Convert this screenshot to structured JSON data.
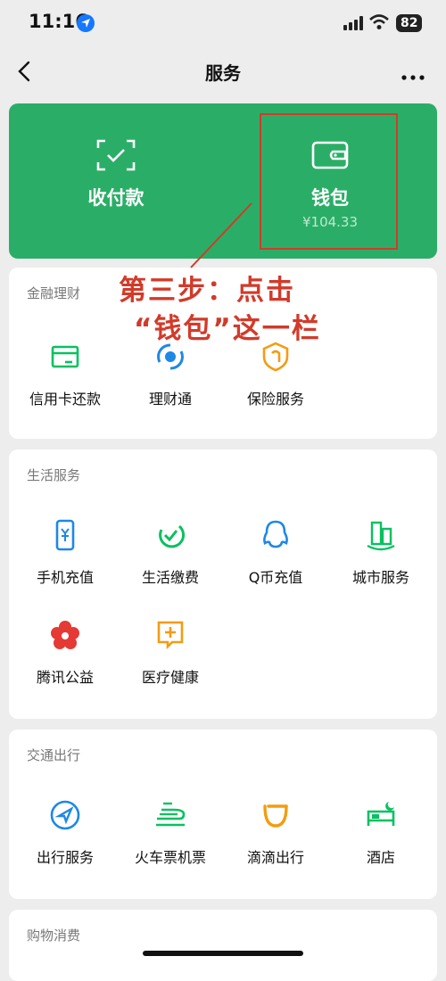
{
  "status": {
    "time": "11:16",
    "battery": "82"
  },
  "nav": {
    "title": "服务"
  },
  "top": {
    "pay_label": "收付款",
    "wallet_label": "钱包",
    "wallet_balance": "¥104.33"
  },
  "annotation": {
    "line1": "第三步：点击",
    "line2": "“钱包”这一栏"
  },
  "finance": {
    "header": "金融理财",
    "items": [
      {
        "label": "信用卡还款",
        "icon": "credit-card-icon"
      },
      {
        "label": "理财通",
        "icon": "wealth-icon"
      },
      {
        "label": "保险服务",
        "icon": "insurance-icon"
      }
    ]
  },
  "life": {
    "header": "生活服务",
    "items": [
      {
        "label": "手机充值",
        "icon": "phone-recharge-icon"
      },
      {
        "label": "生活缴费",
        "icon": "utilities-icon"
      },
      {
        "label": "Q币充值",
        "icon": "qq-coin-icon"
      },
      {
        "label": "城市服务",
        "icon": "city-icon"
      },
      {
        "label": "腾讯公益",
        "icon": "charity-flower-icon"
      },
      {
        "label": "医疗健康",
        "icon": "medical-icon"
      }
    ]
  },
  "transport": {
    "header": "交通出行",
    "items": [
      {
        "label": "出行服务",
        "icon": "compass-icon"
      },
      {
        "label": "火车票机票",
        "icon": "train-icon"
      },
      {
        "label": "滴滴出行",
        "icon": "didi-icon"
      },
      {
        "label": "酒店",
        "icon": "hotel-icon"
      }
    ]
  },
  "shopping": {
    "header": "购物消费"
  },
  "colors": {
    "green": "#2aae67",
    "accent": "#07c160",
    "annotation": "#d23a2a"
  }
}
